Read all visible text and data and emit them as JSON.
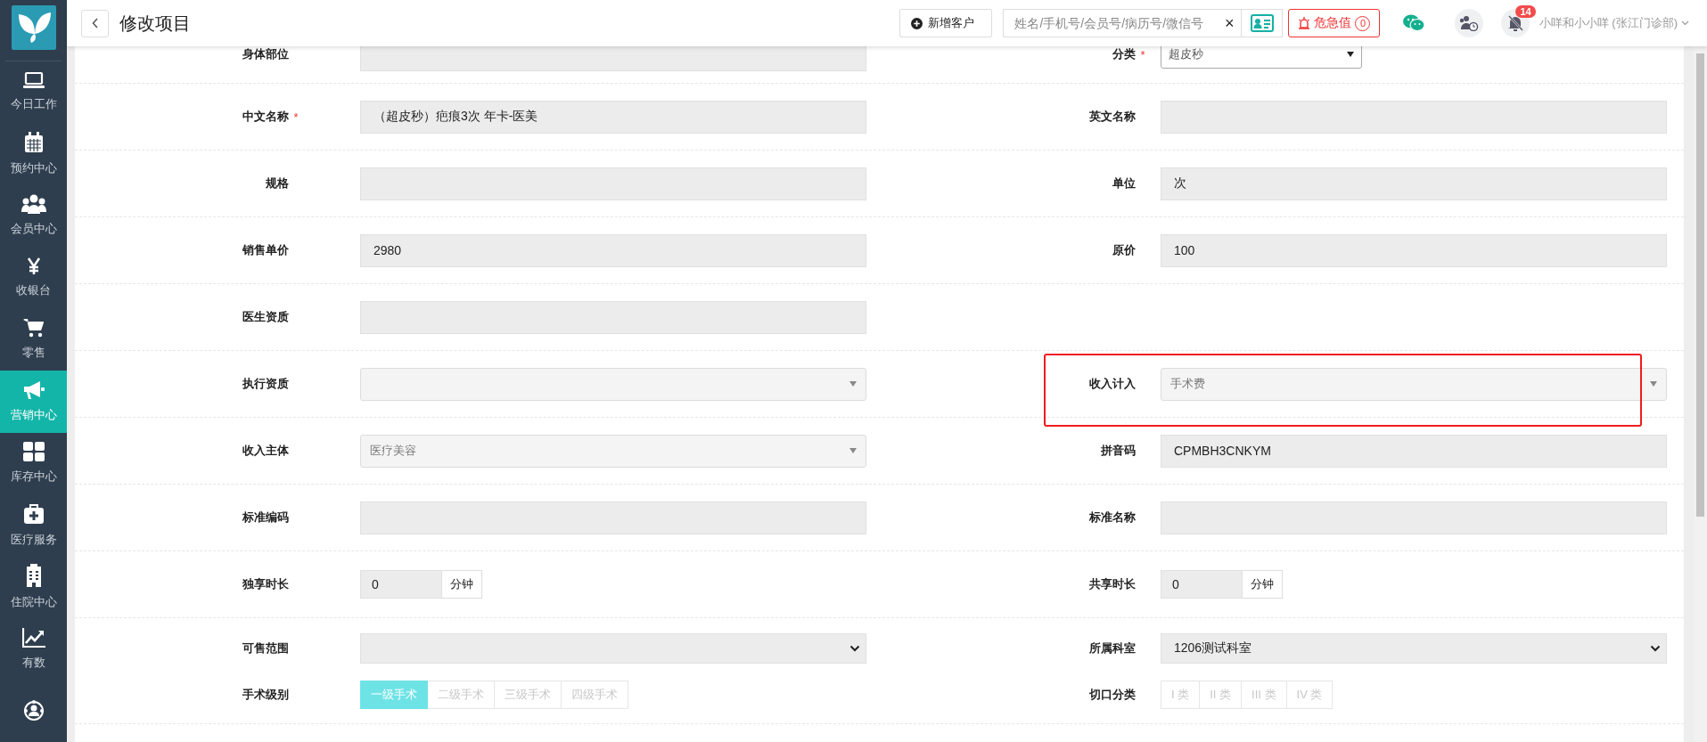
{
  "sidebar": {
    "items": [
      {
        "label": "今日工作",
        "selected": false
      },
      {
        "label": "预约中心",
        "selected": false
      },
      {
        "label": "会员中心",
        "selected": false
      },
      {
        "label": "收银台",
        "selected": false
      },
      {
        "label": "零售",
        "selected": false
      },
      {
        "label": "营销中心",
        "selected": true
      },
      {
        "label": "库存中心",
        "selected": false
      },
      {
        "label": "医疗服务",
        "selected": false
      },
      {
        "label": "住院中心",
        "selected": false
      },
      {
        "label": "有数",
        "selected": false
      },
      {
        "selected": false
      }
    ]
  },
  "header": {
    "title": "修改项目",
    "new_customer_button": "新增客户",
    "search": {
      "placeholder": "姓名/手机号/会员号/病历号/微信号",
      "clear": "×"
    },
    "alert_button": {
      "label": "危急值",
      "count": "0"
    },
    "notification_badge": "14",
    "user": "小咩和小小咩 (张江门诊部)"
  },
  "form": {
    "required_mark": "*",
    "rows": [
      {
        "fields": [
          {
            "label": "身体部位",
            "kind": "text",
            "required": false,
            "highlighted": false
          },
          {
            "label": "分类",
            "kind": "dropdown",
            "value": "超皮秒",
            "required": true,
            "highlighted": false
          }
        ]
      },
      {
        "fields": [
          {
            "label": "中文名称",
            "kind": "text",
            "value": "（超皮秒）疤痕3次 年卡-医美",
            "required": true,
            "highlighted": false
          },
          {
            "label": "英文名称",
            "kind": "text",
            "required": false,
            "highlighted": false
          }
        ]
      },
      {
        "fields": [
          {
            "label": "规格",
            "kind": "text",
            "required": false,
            "highlighted": false
          },
          {
            "label": "单位",
            "kind": "text",
            "value": "次",
            "required": false,
            "highlighted": false
          }
        ]
      },
      {
        "fields": [
          {
            "label": "销售单价",
            "kind": "text",
            "value": "2980",
            "required": false,
            "highlighted": false
          },
          {
            "label": "原价",
            "kind": "text",
            "value": "100",
            "required": false,
            "highlighted": false
          }
        ]
      },
      {
        "fields": [
          {
            "label": "医生资质",
            "kind": "text",
            "required": false,
            "highlighted": false
          }
        ]
      },
      {
        "fields": [
          {
            "label": "执行资质",
            "kind": "select",
            "required": false,
            "highlighted": false
          },
          {
            "label": "收入计入",
            "kind": "select",
            "value": "手术费",
            "required": false,
            "highlighted": true
          }
        ]
      },
      {
        "fields": [
          {
            "label": "收入主体",
            "kind": "select",
            "value": "医疗美容",
            "required": false,
            "highlighted": false
          },
          {
            "label": "拼音码",
            "kind": "text",
            "value": "CPMBH3CNKYM",
            "required": false,
            "highlighted": false
          }
        ]
      },
      {
        "fields": [
          {
            "label": "标准编码",
            "kind": "text",
            "required": false,
            "highlighted": false
          },
          {
            "label": "标准名称",
            "kind": "text",
            "required": false,
            "highlighted": false
          }
        ]
      },
      {
        "fields": [
          {
            "label": "独享时长",
            "kind": "duration",
            "value": "0",
            "unit": "分钟",
            "required": false,
            "highlighted": false
          },
          {
            "label": "共享时长",
            "kind": "duration",
            "value": "0",
            "unit": "分钟",
            "required": false,
            "highlighted": false
          }
        ]
      },
      {
        "fields": [
          {
            "label": "可售范围",
            "kind": "native-select",
            "required": false,
            "highlighted": false
          },
          {
            "label": "所属科室",
            "kind": "native-select",
            "value": "1206测试科室",
            "required": false,
            "highlighted": false
          },
          {
            "label": "手术级别",
            "kind": "segmented",
            "required": false,
            "highlighted": false,
            "options": [
              {
                "label": "一级手术",
                "selected": true
              },
              {
                "label": "二级手术",
                "selected": false
              },
              {
                "label": "三级手术",
                "selected": false
              },
              {
                "label": "四级手术",
                "selected": false
              }
            ]
          },
          {
            "label": "切口分类",
            "kind": "segmented",
            "required": false,
            "highlighted": false,
            "options": [
              {
                "label": "I 类",
                "selected": false
              },
              {
                "label": "II 类",
                "selected": false
              },
              {
                "label": "III 类",
                "selected": false
              },
              {
                "label": "IV 类",
                "selected": false
              }
            ]
          }
        ]
      }
    ]
  }
}
